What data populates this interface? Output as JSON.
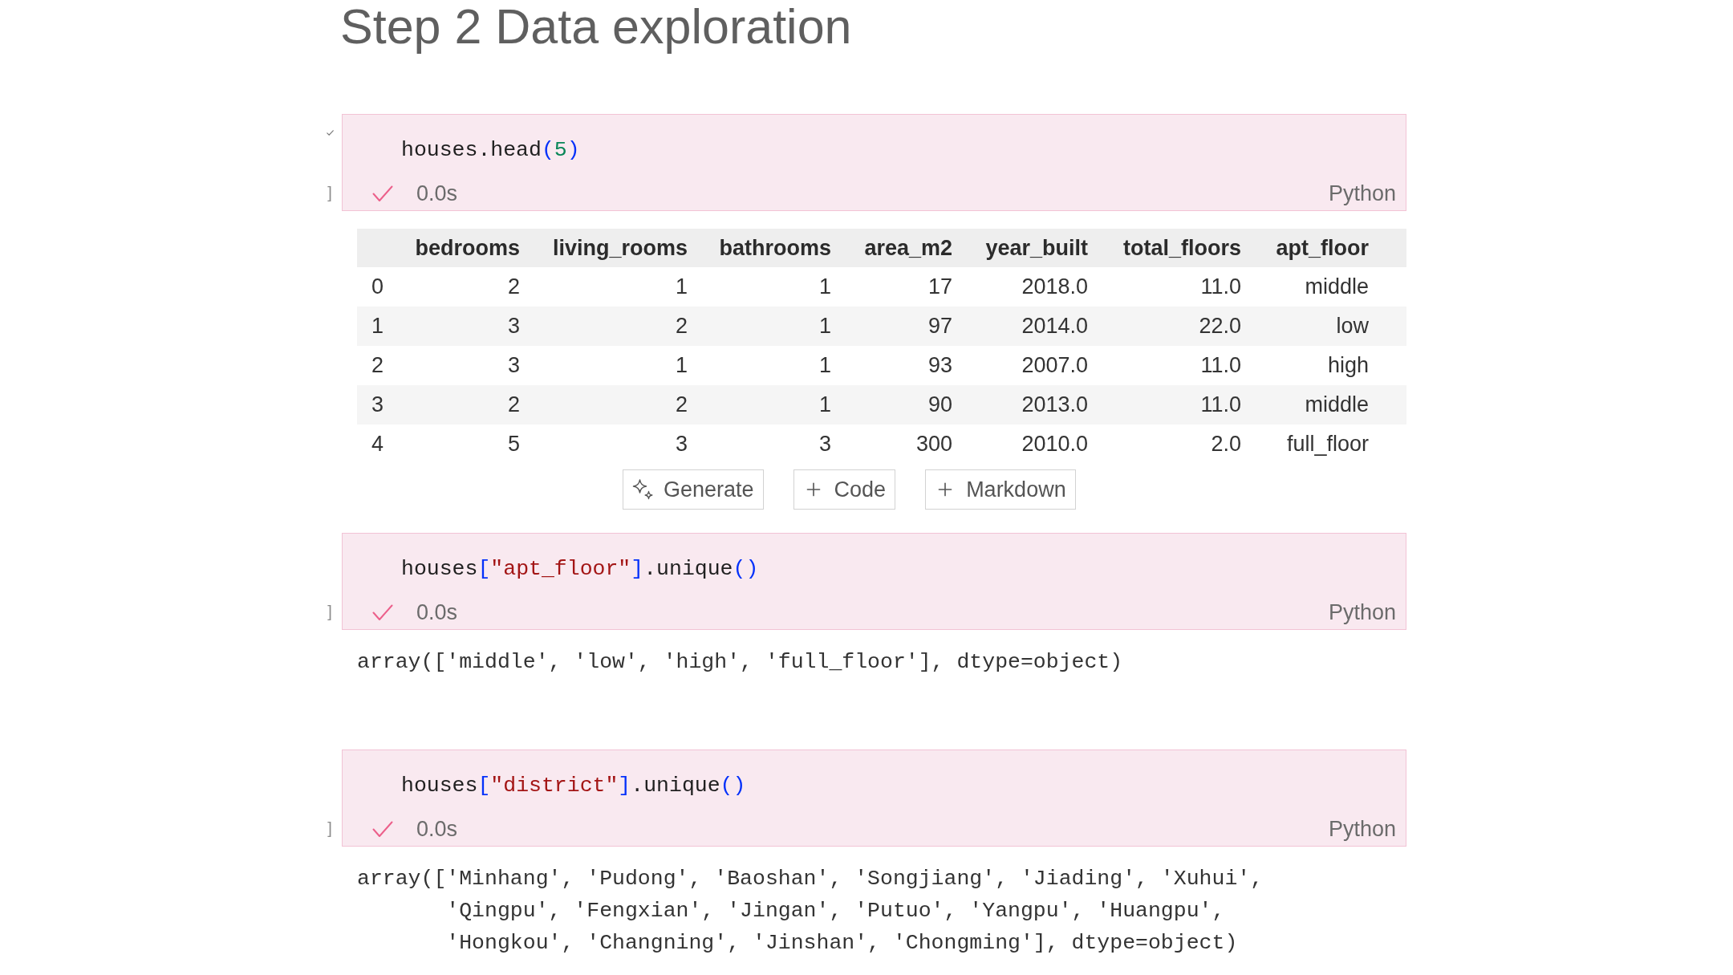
{
  "heading": "Step 2 Data exploration",
  "blocks": [
    {
      "kind": "code_cell",
      "gutter_tick": true,
      "execution_mark": "]",
      "code": [
        {
          "kind": "name",
          "text": "houses.head"
        },
        {
          "kind": "bracket",
          "text": "("
        },
        {
          "kind": "number",
          "text": "5"
        },
        {
          "kind": "bracket",
          "text": ")"
        }
      ],
      "status": {
        "succeeded": true,
        "duration": "0.0s"
      },
      "language": "Python",
      "output": {
        "kind": "table",
        "columns": [
          "bedrooms",
          "living_rooms",
          "bathrooms",
          "area_m2",
          "year_built",
          "total_floors",
          "apt_floor"
        ],
        "rows": [
          {
            "index": "0",
            "cells": [
              "2",
              "1",
              "1",
              "17",
              "2018.0",
              "11.0",
              "middle"
            ]
          },
          {
            "index": "1",
            "cells": [
              "3",
              "2",
              "1",
              "97",
              "2014.0",
              "22.0",
              "low"
            ]
          },
          {
            "index": "2",
            "cells": [
              "3",
              "1",
              "1",
              "93",
              "2007.0",
              "11.0",
              "high"
            ]
          },
          {
            "index": "3",
            "cells": [
              "2",
              "2",
              "1",
              "90",
              "2013.0",
              "11.0",
              "middle"
            ]
          },
          {
            "index": "4",
            "cells": [
              "5",
              "3",
              "3",
              "300",
              "2010.0",
              "2.0",
              "full_floor"
            ]
          }
        ]
      }
    },
    {
      "kind": "insert_toolbar",
      "buttons": [
        {
          "kind": "generate",
          "label": "Generate"
        },
        {
          "kind": "insert",
          "label": "Code"
        },
        {
          "kind": "insert",
          "label": "Markdown"
        }
      ]
    },
    {
      "kind": "code_cell",
      "gutter_tick": false,
      "execution_mark": "]",
      "code": [
        {
          "kind": "name",
          "text": "houses"
        },
        {
          "kind": "bracket",
          "text": "["
        },
        {
          "kind": "string",
          "text": "\"apt_floor\""
        },
        {
          "kind": "bracket",
          "text": "]"
        },
        {
          "kind": "name",
          "text": ".unique"
        },
        {
          "kind": "bracket",
          "text": "()"
        }
      ],
      "status": {
        "succeeded": true,
        "duration": "0.0s"
      },
      "language": "Python",
      "output": {
        "kind": "text",
        "text": "array(['middle', 'low', 'high', 'full_floor'], dtype=object)"
      }
    },
    {
      "kind": "code_cell",
      "gutter_tick": false,
      "execution_mark": "]",
      "code": [
        {
          "kind": "name",
          "text": "houses"
        },
        {
          "kind": "bracket",
          "text": "["
        },
        {
          "kind": "string",
          "text": "\"district\""
        },
        {
          "kind": "bracket",
          "text": "]"
        },
        {
          "kind": "name",
          "text": ".unique"
        },
        {
          "kind": "bracket",
          "text": "()"
        }
      ],
      "status": {
        "succeeded": true,
        "duration": "0.0s"
      },
      "language": "Python",
      "output": {
        "kind": "text",
        "text": "array(['Minhang', 'Pudong', 'Baoshan', 'Songjiang', 'Jiading', 'Xuhui',\n       'Qingpu', 'Fengxian', 'Jingan', 'Putuo', 'Yangpu', 'Huangpu',\n       'Hongkou', 'Changning', 'Jinshan', 'Chongming'], dtype=object)"
      }
    }
  ]
}
